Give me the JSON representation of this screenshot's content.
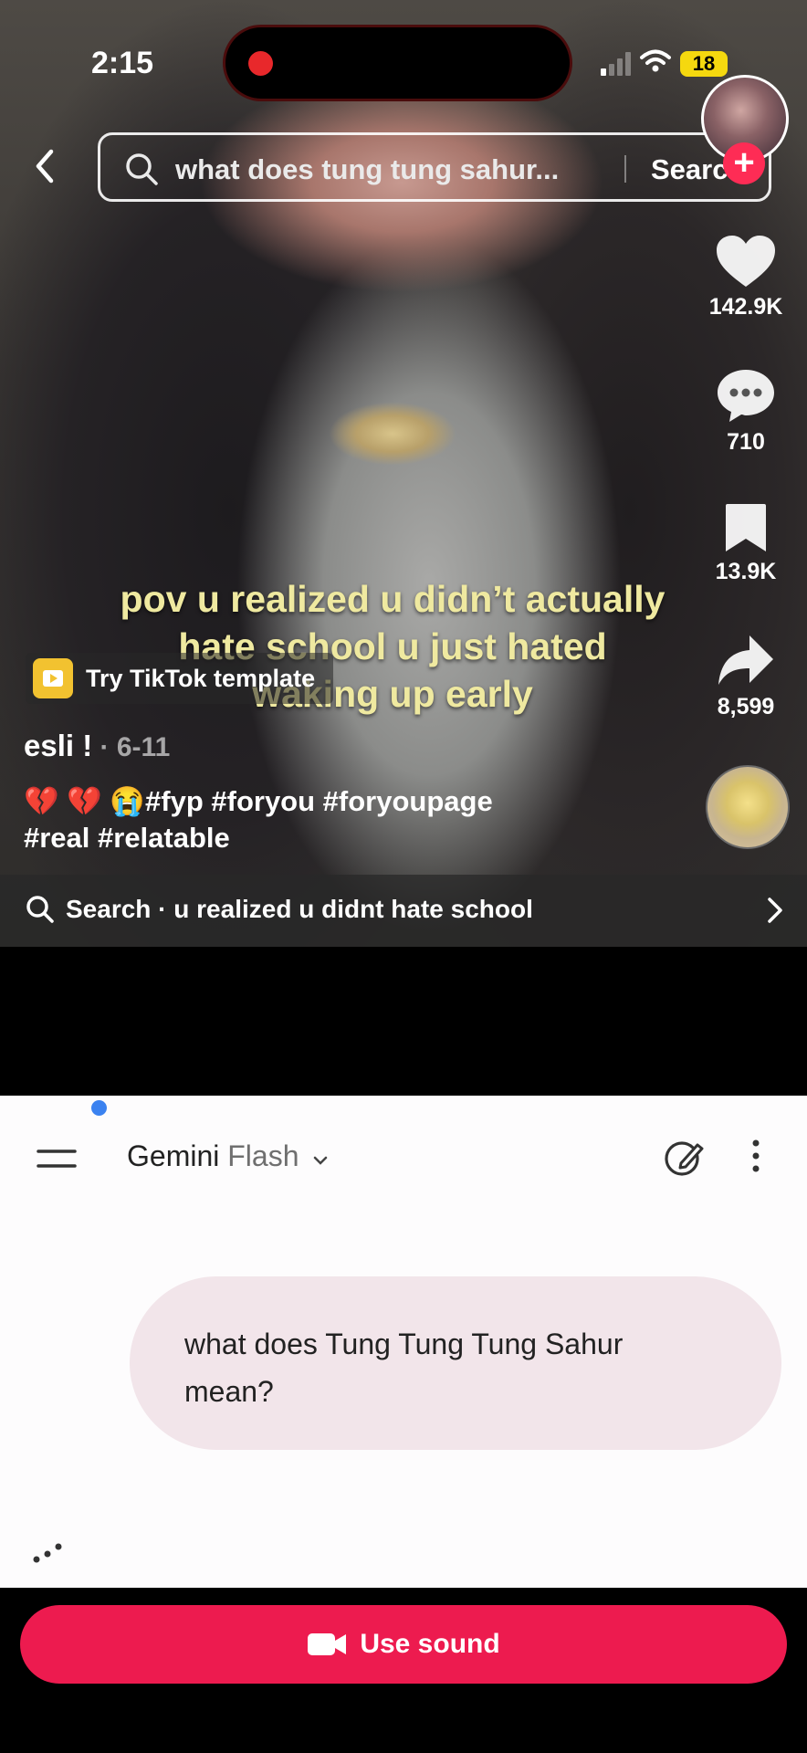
{
  "status_bar": {
    "time": "2:15",
    "battery": "18"
  },
  "search": {
    "query": "what does tung tung sahur...",
    "button": "Search"
  },
  "actions": {
    "likes": "142.9K",
    "comments": "710",
    "saves": "13.9K",
    "shares": "8,599"
  },
  "video": {
    "caption_lines": [
      "pov u realized u didn’t actually",
      "hate school u just hated",
      "waking up early"
    ],
    "template_label": "Try TikTok template",
    "author": "esli !",
    "date": " · 6-11",
    "description_line1": "💔 💔 😭#fyp #foryou #foryoupage",
    "description_line2": "#real #relatable"
  },
  "search_strip": {
    "text": "Search · u realized u didnt hate school"
  },
  "gemini": {
    "app_name": "Gemini",
    "model": "Flash",
    "prompt_line1": "what does Tung Tung Tung Sahur",
    "prompt_line2": "mean?"
  },
  "use_sound": {
    "label": "Use sound"
  },
  "colors": {
    "accent": "#ed1b4f",
    "follow": "#fe2c55",
    "caption": "#efe9a0"
  }
}
